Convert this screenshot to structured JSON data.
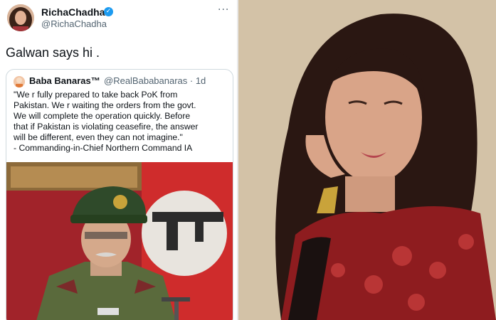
{
  "tweet": {
    "display_name": "RichaChadha",
    "handle": "@RichaChadha",
    "verified_glyph": "✓",
    "more_glyph": "···",
    "text": "Galwan says hi ."
  },
  "quote": {
    "name": "Baba Banaras™",
    "handle_time": "@RealBababanaras · 1d",
    "lines": [
      "\"We r fully prepared to take back PoK from",
      "Pakistan. We r waiting the orders from the govt.",
      "We will complete the operation quickly. Before",
      "that if Pakistan is violating ceasefire, the answer",
      "will be different, even they can not imagine.\"",
      "- Commanding-in-Chief Northern Command IA"
    ]
  },
  "colors": {
    "verified": "#1d9bf0",
    "text": "#0f1419",
    "secondary": "#536471",
    "border": "#cfd9de",
    "saree_red": "#8e1c1f"
  },
  "icons": [
    "verified-badge-icon",
    "more-options-icon"
  ]
}
